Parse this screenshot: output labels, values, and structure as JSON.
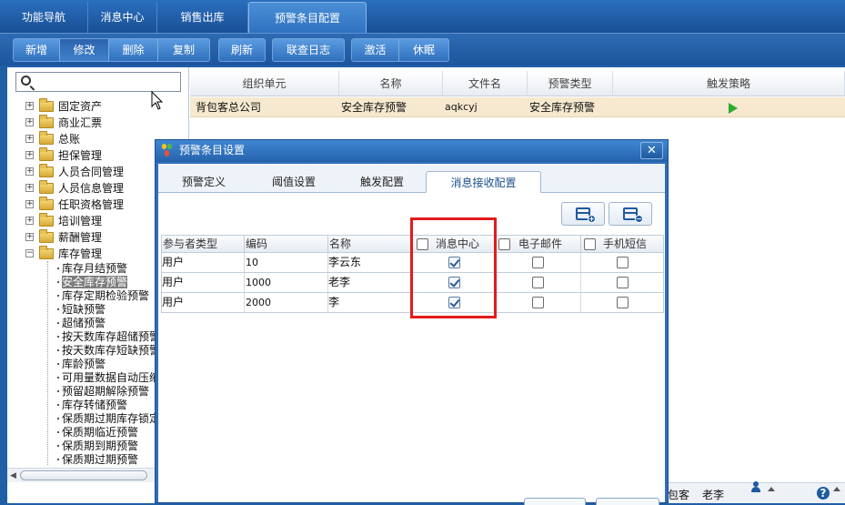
{
  "top_tabs": [
    {
      "label": "功能导航"
    },
    {
      "label": "消息中心"
    },
    {
      "label": "销售出库"
    },
    {
      "label": "预警条目配置"
    }
  ],
  "toolbar": {
    "new": "新增",
    "edit": "修改",
    "delete": "删除",
    "copy": "复制",
    "refresh": "刷新",
    "log": "联查日志",
    "activate": "激活",
    "sleep": "休眠"
  },
  "search": {
    "placeholder": ""
  },
  "tree": {
    "folders": [
      {
        "label": "固定资产",
        "expander": "+"
      },
      {
        "label": "商业汇票",
        "expander": "+"
      },
      {
        "label": "总账",
        "expander": "+"
      },
      {
        "label": "担保管理",
        "expander": "+"
      },
      {
        "label": "人员合同管理",
        "expander": "+"
      },
      {
        "label": "人员信息管理",
        "expander": "+"
      },
      {
        "label": "任职资格管理",
        "expander": "+"
      },
      {
        "label": "培训管理",
        "expander": "+"
      },
      {
        "label": "薪酬管理",
        "expander": "+"
      },
      {
        "label": "库存管理",
        "expander": "−"
      }
    ],
    "leaves": [
      {
        "label": "库存月结预警"
      },
      {
        "label": "安全库存预警",
        "selected": true
      },
      {
        "label": "库存定期检验预警"
      },
      {
        "label": "短缺预警"
      },
      {
        "label": "超储预警"
      },
      {
        "label": "按天数库存超储预警"
      },
      {
        "label": "按天数库存短缺预警"
      },
      {
        "label": "库龄预警"
      },
      {
        "label": "可用量数据自动压缩"
      },
      {
        "label": "预留超期解除预警"
      },
      {
        "label": "库存转储预警"
      },
      {
        "label": "保质期过期库存锁定"
      },
      {
        "label": "保质期临近预警"
      },
      {
        "label": "保质期到期预警"
      },
      {
        "label": "保质期过期预警"
      }
    ]
  },
  "grid": {
    "headers": [
      "组织单元",
      "名称",
      "文件名",
      "预警类型",
      "触发策略"
    ],
    "rows": [
      {
        "org": "背包客总公司",
        "name": "安全库存预警",
        "file": "aqkcyj",
        "type": "安全库存预警"
      }
    ]
  },
  "status": {
    "company": "包客",
    "user": "老李"
  },
  "dialog": {
    "title": "预警条目设置",
    "close": "✕",
    "tabs": [
      "预警定义",
      "阈值设置",
      "触发配置",
      "消息接收配置"
    ],
    "active_tab": 3,
    "table": {
      "headers": [
        "参与者类型",
        "编码",
        "名称",
        "消息中心",
        "电子邮件",
        "手机短信"
      ],
      "rows": [
        {
          "type": "用户",
          "code": "10",
          "name": "李云东",
          "msg": true,
          "email": false,
          "sms": false
        },
        {
          "type": "用户",
          "code": "1000",
          "name": "老李",
          "msg": true,
          "email": false,
          "sms": false
        },
        {
          "type": "用户",
          "code": "2000",
          "name": "李",
          "msg": true,
          "email": false,
          "sms": false
        }
      ]
    }
  },
  "colors": {
    "accent": "#2f6fb8",
    "highlight_row": "#f7e9cf",
    "annotation": "#e21b1b"
  }
}
